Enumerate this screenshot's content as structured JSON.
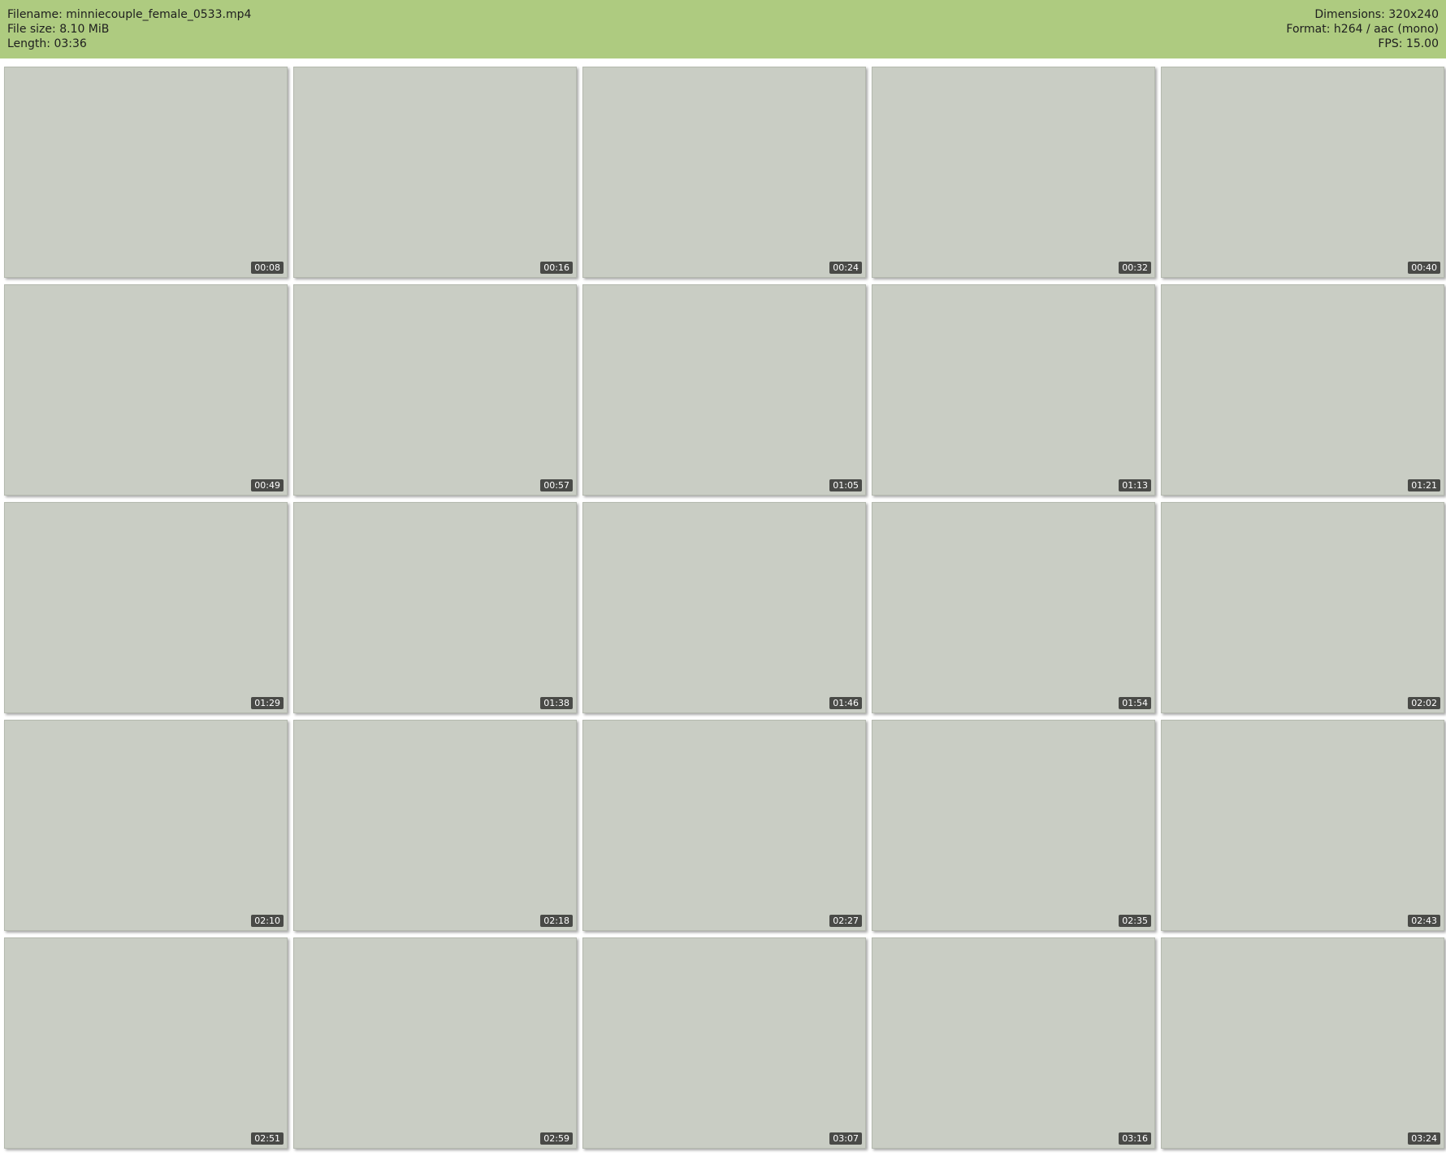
{
  "header": {
    "filename": "Filename: minniecouple_female_0533.mp4",
    "filesize": "File size: 8.10 MiB",
    "length": "Length: 03:36",
    "dimensions": "Dimensions: 320x240",
    "format": "Format: h264 / aac (mono)",
    "fps": "FPS: 15.00"
  },
  "frames": [
    "00:08",
    "00:16",
    "00:24",
    "00:32",
    "00:40",
    "00:49",
    "00:57",
    "01:05",
    "01:13",
    "01:21",
    "01:29",
    "01:38",
    "01:46",
    "01:54",
    "02:02",
    "02:10",
    "02:18",
    "02:27",
    "02:35",
    "02:43",
    "02:51",
    "02:59",
    "03:07",
    "03:16",
    "03:24"
  ]
}
